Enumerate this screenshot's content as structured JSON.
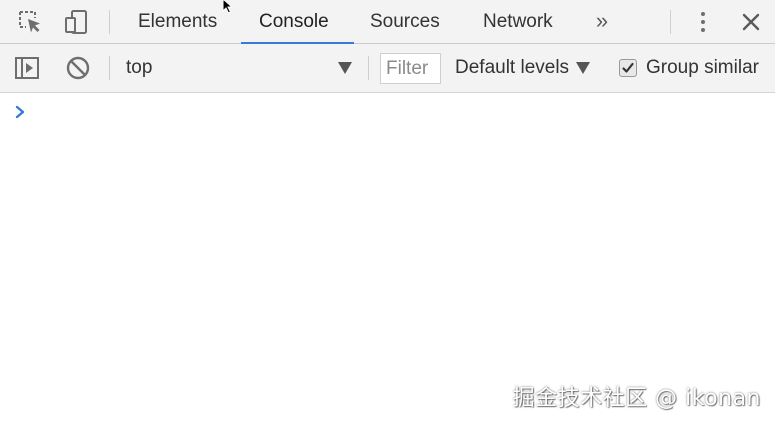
{
  "tabs": [
    {
      "label": "Elements"
    },
    {
      "label": "Console",
      "active": true
    },
    {
      "label": "Sources"
    },
    {
      "label": "Network"
    }
  ],
  "tabbar": {
    "inspect_icon": "inspect-element-icon",
    "device_icon": "device-toolbar-icon",
    "more_tabs": "»",
    "menu_icon": "kebab-menu-icon",
    "close_icon": "close-icon"
  },
  "toolbar": {
    "sidebar_toggle_icon": "show-sidebar-icon",
    "clear_icon": "clear-console-icon",
    "context": "top",
    "filter_placeholder": "Filter",
    "filter_value": "",
    "levels": "Default levels",
    "group_similar": "Group similar",
    "group_similar_checked": true
  },
  "console": {
    "prompt_icon": "prompt-chevron-icon"
  },
  "watermark": "掘金技术社区 @ ikonan",
  "colors": {
    "accent": "#3879d9",
    "toolbar_bg": "#f3f3f3",
    "prompt": "#3879d9"
  }
}
